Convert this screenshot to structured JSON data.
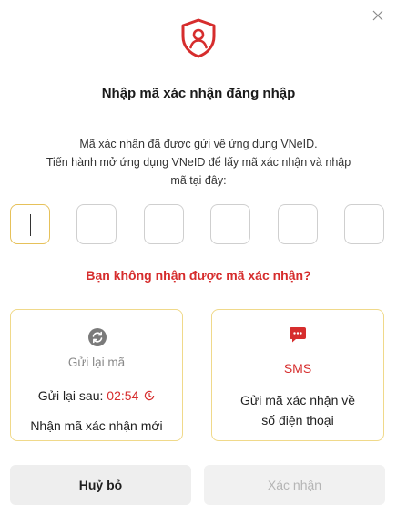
{
  "dialog": {
    "title": "Nhập mã xác nhận đăng nhập",
    "description_line1": "Mã xác nhận đã được gửi về ứng dụng VNeID.",
    "description_line2": "Tiến hành mở ứng dụng VNeID để lấy mã xác nhận và nhập",
    "description_line3": "mã tại đây:",
    "otp_length": 6,
    "not_received": "Bạn không nhận được mã xác nhận?"
  },
  "resend_card": {
    "icon": "refresh-icon",
    "title": "Gửi lại mã",
    "countdown_label": "Gửi lại sau:",
    "countdown_value": "02:54",
    "description": "Nhận mã xác nhận mới"
  },
  "sms_card": {
    "icon": "sms-icon",
    "title": "SMS",
    "description_line1": "Gửi mã xác nhận về",
    "description_line2": "số điện thoại"
  },
  "actions": {
    "cancel_label": "Huỷ bỏ",
    "confirm_label": "Xác nhận"
  },
  "colors": {
    "accent_red": "#d62d2d",
    "card_border": "#f0d98a",
    "otp_active_border": "#e6c15a"
  }
}
